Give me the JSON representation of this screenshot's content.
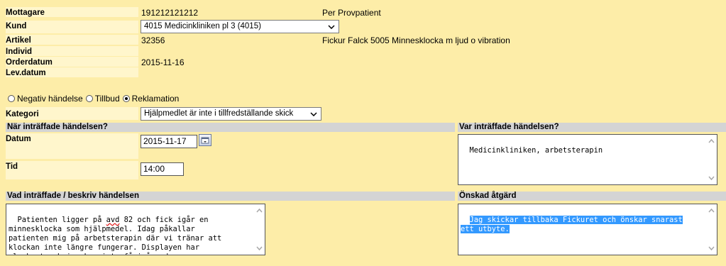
{
  "header": {
    "mottagare": {
      "label": "Mottagare",
      "value": "191212121212",
      "name": "Per Provpatient"
    },
    "kund": {
      "label": "Kund",
      "selected": "4015 Medicinkliniken pl 3 (4015)"
    },
    "artikel": {
      "label": "Artikel",
      "value": "32356",
      "description": "Fickur Falck 5005 Minnesklocka m ljud o vibration"
    },
    "individ": {
      "label": "Individ",
      "value": ""
    },
    "orderdatum": {
      "label": "Orderdatum",
      "value": "2015-11-16"
    },
    "levdatum": {
      "label": "Lev.datum",
      "value": ""
    }
  },
  "event_type": {
    "options": [
      {
        "label": "Negativ händelse",
        "checked": false
      },
      {
        "label": "Tillbud",
        "checked": false
      },
      {
        "label": "Reklamation",
        "checked": true
      }
    ]
  },
  "kategori": {
    "label": "Kategori",
    "selected": "Hjälpmedlet är inte i tillfredställande skick"
  },
  "when": {
    "section_title": "När inträffade händelsen?",
    "datum_label": "Datum",
    "datum_value": "2015-11-17",
    "tid_label": "Tid",
    "tid_value": "14:00"
  },
  "where": {
    "section_title": "Var inträffade händelsen?",
    "value": "Medicinkliniken, arbetsterapin"
  },
  "describe": {
    "section_title": "Vad inträffade / beskriv händelsen",
    "text_before": "Patienten ligger på ",
    "misspelled": "avd",
    "text_after": " 82 och fick igår en\nminnesklocka som hjälpmedel. Idag påkallar\npatienten mig på arbetsterapin där vi tränar att\nklockan inte längre fungerar. Displayen har\nslocknat och jag kan inte få igång den."
  },
  "action": {
    "section_title": "Önskad åtgärd",
    "line1": "Jag skickar tillbaka Fickuret och önskar snarast",
    "line2": "ett utbyte."
  },
  "colors": {
    "background": "#fdeda8",
    "label_bg": "#fff6cc",
    "section_bg": "#d4d4d4",
    "selection": "#3399ff"
  }
}
